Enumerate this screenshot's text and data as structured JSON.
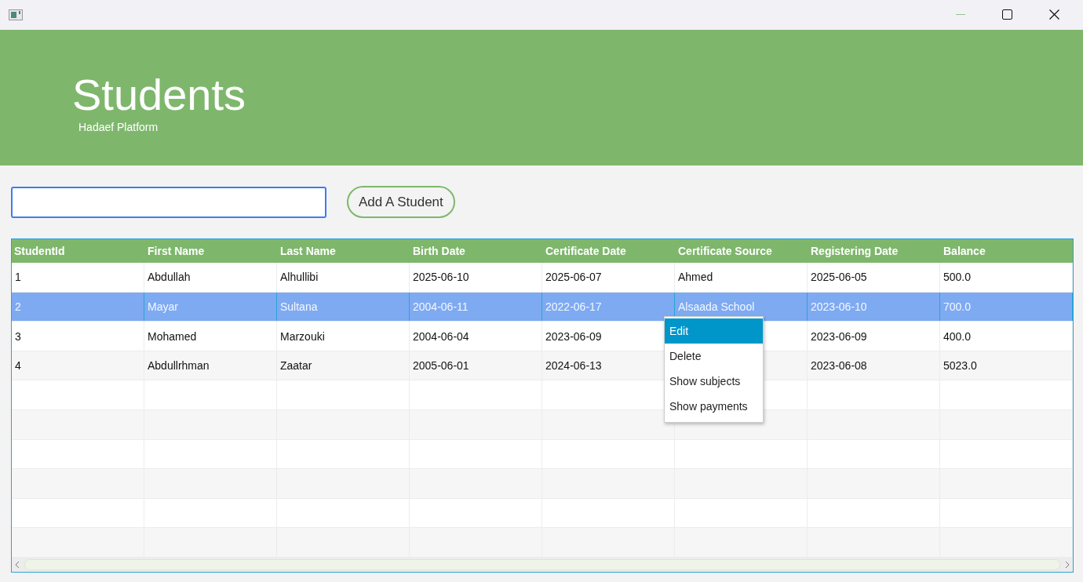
{
  "header": {
    "title": "Students",
    "subtitle": "Hadaef Platform"
  },
  "search": {
    "focused": true
  },
  "add_button": "Add A Student",
  "table": {
    "columns": [
      "StudentId",
      "First Name",
      "Last Name",
      "Birth Date",
      "Certificate Date",
      "Certificate Source",
      "Registering Date",
      "Balance"
    ],
    "rows": [
      {
        "selected": false,
        "cells": [
          "1",
          "Abdullah",
          "Alhullibi",
          "2025-06-10",
          "2025-06-07",
          "Ahmed",
          "2025-06-05",
          "500.0"
        ]
      },
      {
        "selected": true,
        "cells": [
          "2",
          "Mayar",
          "Sultana",
          "2004-06-11",
          "2022-06-17",
          "Alsaada School",
          "2023-06-10",
          "700.0"
        ]
      },
      {
        "selected": false,
        "cells": [
          "3",
          "Mohamed",
          "Marzouki",
          "2004-06-04",
          "2023-06-09",
          null,
          "2023-06-09",
          "400.0"
        ]
      },
      {
        "selected": false,
        "cells": [
          "4",
          "Abdullrhman",
          "Zaatar",
          "2005-06-01",
          "2024-06-13",
          null,
          "2023-06-08",
          "5023.0"
        ]
      }
    ]
  },
  "context_menu": [
    {
      "label": "Edit",
      "selected": true
    },
    {
      "label": "Delete",
      "selected": false
    },
    {
      "label": "Show subjects",
      "selected": false
    },
    {
      "label": "Show payments",
      "selected": false
    }
  ]
}
